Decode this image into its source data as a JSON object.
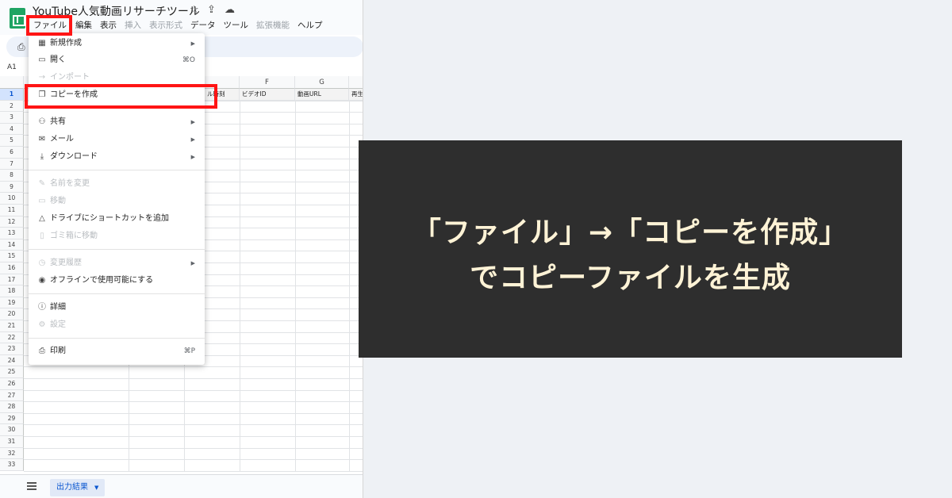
{
  "doc_title": "YouTube人気動画リサーチツール",
  "menu": [
    "ファイル",
    "編集",
    "表示",
    "挿入",
    "表示形式",
    "データ",
    "ツール",
    "拡張機能",
    "ヘルプ"
  ],
  "name_box": "A1",
  "columns": [
    "F",
    "G"
  ],
  "header_row": [
    "ビデオID",
    "動画URL",
    "再生"
  ],
  "header_partial": "ル時刻",
  "rows": [
    "1",
    "2",
    "3",
    "4",
    "5",
    "6",
    "7",
    "8",
    "9",
    "10",
    "11",
    "12",
    "13",
    "14",
    "15",
    "16",
    "17",
    "18",
    "19",
    "20",
    "21",
    "22",
    "23",
    "24",
    "25",
    "26",
    "27",
    "28",
    "29",
    "30",
    "31",
    "32",
    "33"
  ],
  "file_menu": {
    "new": "新規作成",
    "open": "開く",
    "open_shortcut": "⌘O",
    "import": "インポート",
    "make_copy": "コピーを作成",
    "share": "共有",
    "email": "メール",
    "download": "ダウンロード",
    "rename": "名前を変更",
    "move": "移動",
    "add_shortcut": "ドライブにショートカットを追加",
    "trash": "ゴミ箱に移動",
    "version_history": "変更履歴",
    "offline": "オフラインで使用可能にする",
    "details": "詳細",
    "settings": "設定",
    "print": "印刷",
    "print_shortcut": "⌘P"
  },
  "sheet_tab": "出力結果",
  "callout": {
    "line1": "「ファイル」→「コピーを作成」",
    "line2": "でコピーファイルを生成"
  },
  "colors": {
    "highlight": "#ff1515",
    "callout_bg": "#2e2e2e",
    "callout_text": "#fff3d6",
    "sheets_green": "#1fa463"
  }
}
